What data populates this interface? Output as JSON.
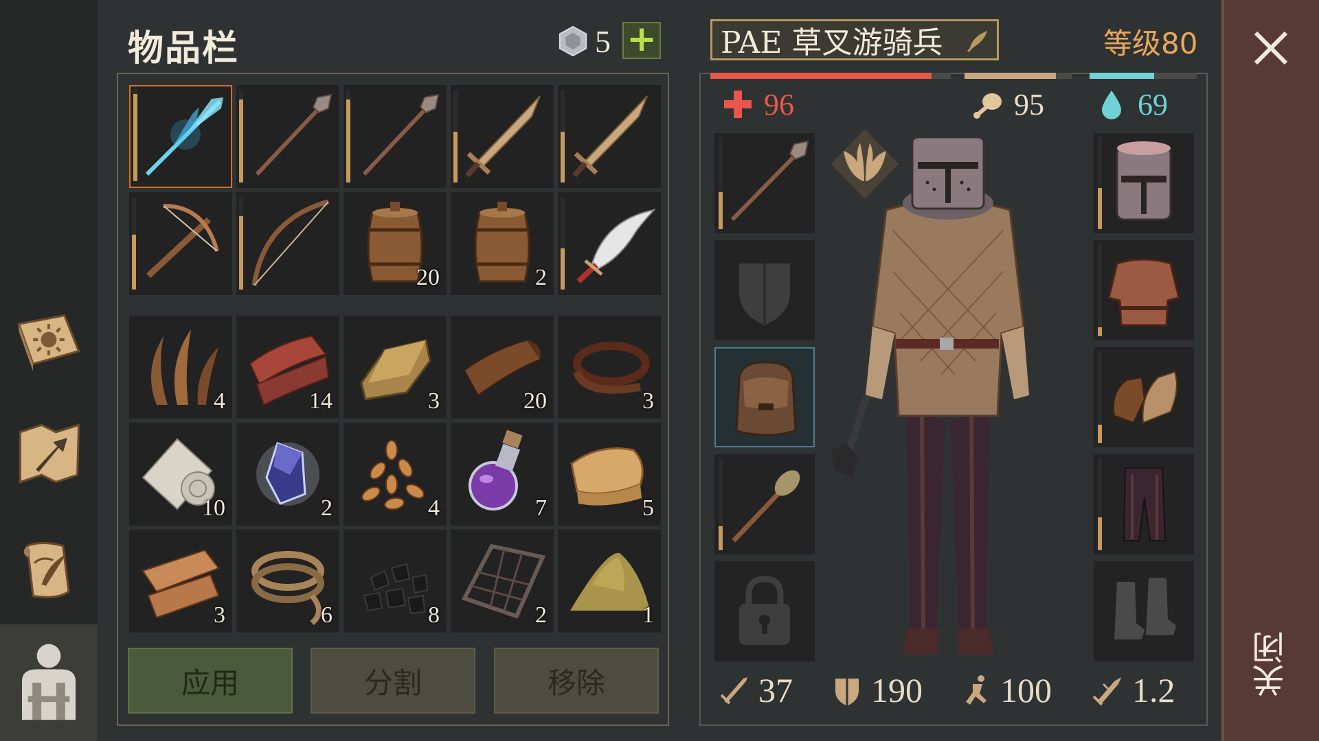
{
  "inventory": {
    "title": "物品栏",
    "gems": "5",
    "add_label": "+",
    "weapons": [
      {
        "name": "ice-spear-icon",
        "qty": "",
        "dura": 0.95,
        "selected": true
      },
      {
        "name": "spear-icon",
        "qty": "",
        "dura": 0.9
      },
      {
        "name": "spear-icon",
        "qty": "",
        "dura": 0.9
      },
      {
        "name": "sword-icon",
        "qty": "",
        "dura": 0.55
      },
      {
        "name": "sword-icon",
        "qty": "",
        "dura": 0.55
      },
      {
        "name": "crossbow-icon",
        "qty": "",
        "dura": 0.6
      },
      {
        "name": "bow-icon",
        "qty": "",
        "dura": 0.8
      },
      {
        "name": "barrel-icon",
        "qty": "20"
      },
      {
        "name": "barrel-icon",
        "qty": "2"
      },
      {
        "name": "scimitar-icon",
        "qty": "",
        "dura": 0.45
      }
    ],
    "items": [
      {
        "name": "fiber-icon",
        "qty": "4"
      },
      {
        "name": "raw-leather-icon",
        "qty": "14"
      },
      {
        "name": "ingot-icon",
        "qty": "3"
      },
      {
        "name": "tanned-leather-icon",
        "qty": "20"
      },
      {
        "name": "leather-strap-icon",
        "qty": "3"
      },
      {
        "name": "cloth-roll-icon",
        "qty": "10"
      },
      {
        "name": "crystal-icon",
        "qty": "2"
      },
      {
        "name": "seeds-icon",
        "qty": "4"
      },
      {
        "name": "potion-icon",
        "qty": "7"
      },
      {
        "name": "folded-cloth-icon",
        "qty": "5"
      },
      {
        "name": "fabric-icon",
        "qty": "3"
      },
      {
        "name": "rope-icon",
        "qty": "6"
      },
      {
        "name": "coal-icon",
        "qty": "8"
      },
      {
        "name": "grate-icon",
        "qty": "2"
      },
      {
        "name": "sand-pile-icon",
        "qty": "1"
      }
    ],
    "buttons": {
      "apply": "应用",
      "split": "分割",
      "remove": "移除"
    }
  },
  "character": {
    "name": "PAE 草叉游骑兵",
    "level": "等级80",
    "health": "96",
    "food": "95",
    "water": "69",
    "health_fill": 0.92,
    "food_fill": 0.85,
    "water_fill": 0.6,
    "damage": "37",
    "defense": "190",
    "speed": "100",
    "weight": "1.2"
  },
  "close": {
    "label": "关闭"
  },
  "colors": {
    "accent": "#d66e21",
    "health": "#e9564c",
    "water": "#6fd3d6",
    "level": "#e8a75a"
  }
}
